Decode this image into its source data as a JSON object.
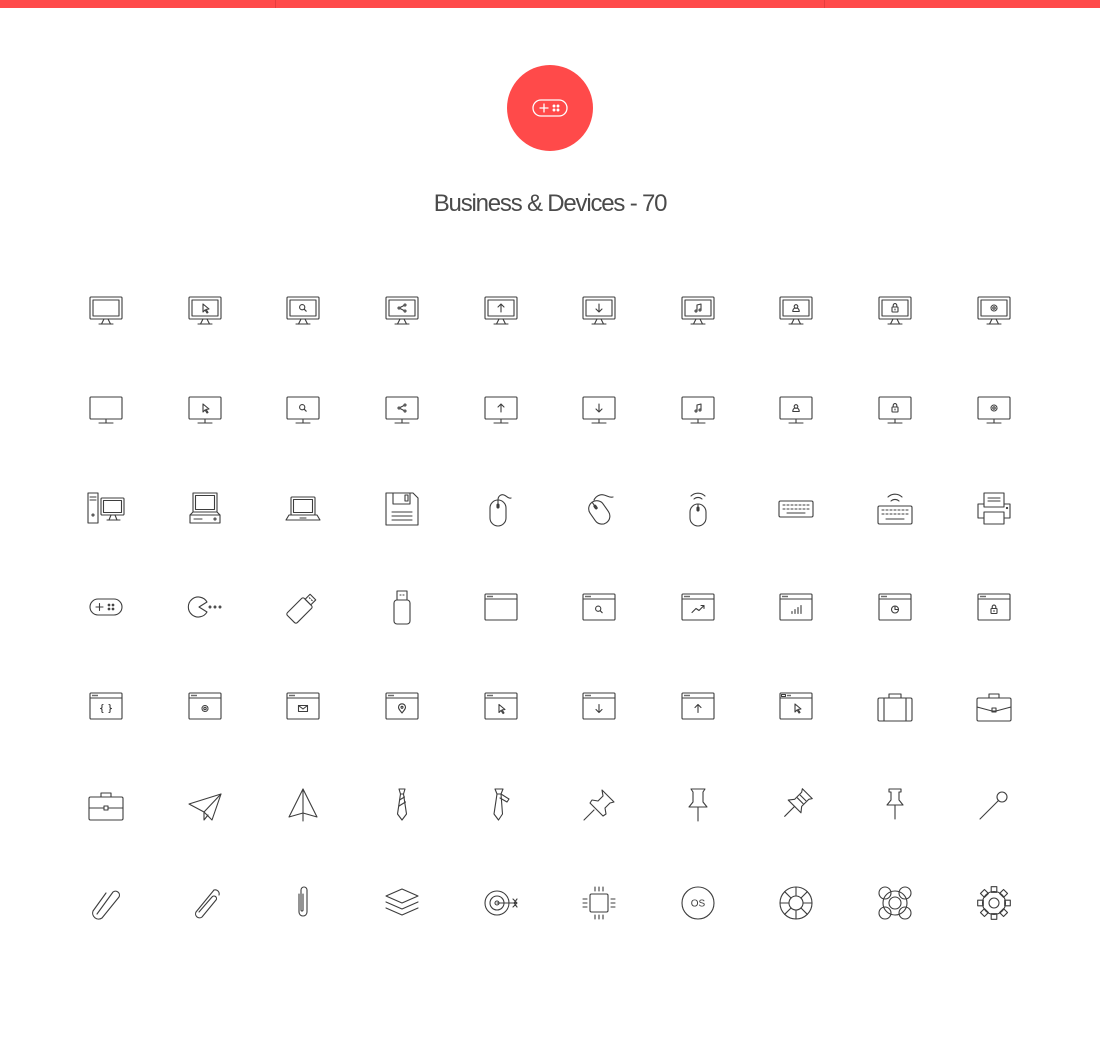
{
  "header": {
    "title": "Business & Devices - 70",
    "accent_color": "#ff4a4a",
    "badge_icon": "gamepad-icon"
  },
  "icons": [
    "monitor-icon",
    "monitor-cursor-icon",
    "monitor-search-icon",
    "monitor-share-icon",
    "monitor-upload-icon",
    "monitor-download-icon",
    "monitor-music-icon",
    "monitor-user-icon",
    "monitor-lock-icon",
    "monitor-settings-icon",
    "screen-icon",
    "screen-cursor-icon",
    "screen-search-icon",
    "screen-share-icon",
    "screen-upload-icon",
    "screen-download-icon",
    "screen-music-icon",
    "screen-user-icon",
    "screen-lock-icon",
    "screen-settings-icon",
    "desktop-tower-icon",
    "retro-computer-icon",
    "laptop-icon",
    "floppy-disk-icon",
    "mouse-icon",
    "mouse-tilted-icon",
    "wireless-mouse-icon",
    "keyboard-icon",
    "wireless-keyboard-icon",
    "printer-icon",
    "gamepad-icon",
    "pacman-icon",
    "usb-stick-tilted-icon",
    "usb-stick-icon",
    "browser-window-icon",
    "browser-search-icon",
    "browser-trend-icon",
    "browser-bar-chart-icon",
    "browser-pie-chart-icon",
    "browser-lock-icon",
    "browser-code-icon",
    "browser-settings-icon",
    "browser-mail-icon",
    "browser-location-icon",
    "browser-cursor-icon",
    "browser-download-icon",
    "browser-upload-icon",
    "browser-click-icon",
    "suitcase-icon",
    "briefcase-icon",
    "briefcase-alt-icon",
    "paper-plane-icon",
    "paper-sail-icon",
    "tie-icon",
    "tie-loose-icon",
    "push-pin-tilted-icon",
    "push-pin-icon",
    "push-pin-alt-icon",
    "thumbtack-icon",
    "map-pin-needle-icon",
    "paperclip-icon",
    "paperclip-alt-icon",
    "paperclip-vertical-icon",
    "layers-icon",
    "target-arrow-icon",
    "cpu-chip-icon",
    "os-badge-icon",
    "lifebuoy-icon",
    "lifebuoy-alt-icon",
    "gear-icon"
  ],
  "labels": {
    "os": "OS"
  }
}
